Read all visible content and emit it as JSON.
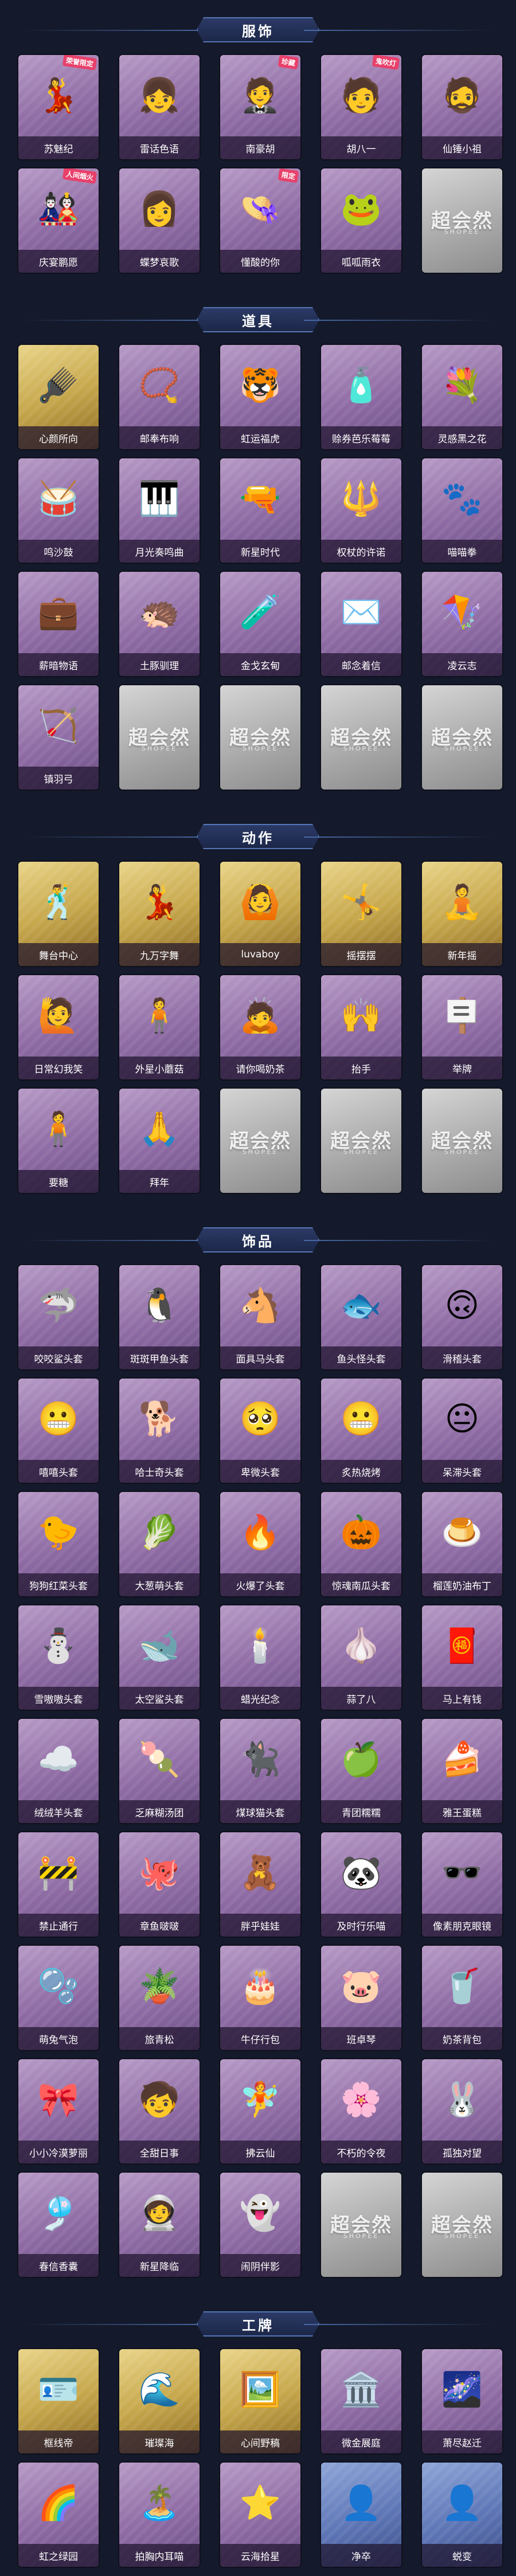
{
  "sections": [
    {
      "title": "服饰",
      "items": [
        {
          "label": "苏魅纪",
          "style": "purple",
          "icon": "💃",
          "tag": "荣誉限定"
        },
        {
          "label": "雷话色语",
          "style": "purple",
          "icon": "👧",
          "tag": ""
        },
        {
          "label": "南豪胡",
          "style": "purple",
          "icon": "🤵",
          "tag": "珍藏"
        },
        {
          "label": "胡八一",
          "style": "purple",
          "icon": "🧑",
          "tag": "鬼吹灯"
        },
        {
          "label": "仙锤小祖",
          "style": "purple",
          "icon": "🧔",
          "tag": ""
        },
        {
          "label": "庆宴鹏愿",
          "style": "purple",
          "icon": "🎎",
          "tag": "人间烟火"
        },
        {
          "label": "蝶梦哀歌",
          "style": "purple",
          "icon": "👩",
          "tag": ""
        },
        {
          "label": "懂酸的你",
          "style": "purple",
          "icon": "👒",
          "tag": "限定"
        },
        {
          "label": "呱呱雨衣",
          "style": "purple",
          "icon": "🐸",
          "tag": ""
        },
        {
          "label": "",
          "style": "placeholder",
          "icon": "",
          "tag": ""
        }
      ]
    },
    {
      "title": "道具",
      "items": [
        {
          "label": "心颜所向",
          "style": "gold",
          "icon": "🪮",
          "tag": ""
        },
        {
          "label": "邮奉布响",
          "style": "purple",
          "icon": "📿",
          "tag": ""
        },
        {
          "label": "虹运福虎",
          "style": "purple",
          "icon": "🐯",
          "tag": ""
        },
        {
          "label": "赊券芭乐莓莓",
          "style": "purple",
          "icon": "🧴",
          "tag": ""
        },
        {
          "label": "灵感黑之花",
          "style": "purple",
          "icon": "💐",
          "tag": ""
        },
        {
          "label": "鸣沙鼓",
          "style": "purple",
          "icon": "🥁",
          "tag": ""
        },
        {
          "label": "月光奏鸣曲",
          "style": "purple",
          "icon": "🎹",
          "tag": ""
        },
        {
          "label": "新星时代",
          "style": "purple",
          "icon": "🔫",
          "tag": ""
        },
        {
          "label": "权杖的许诺",
          "style": "purple",
          "icon": "🔱",
          "tag": ""
        },
        {
          "label": "喵喵拳",
          "style": "purple",
          "icon": "🐾",
          "tag": ""
        },
        {
          "label": "薪暗物语",
          "style": "purple",
          "icon": "💼",
          "tag": ""
        },
        {
          "label": "土豚驯理",
          "style": "purple",
          "icon": "🦔",
          "tag": ""
        },
        {
          "label": "金戈玄甸",
          "style": "purple",
          "icon": "🧪",
          "tag": ""
        },
        {
          "label": "邮念着信",
          "style": "purple",
          "icon": "✉️",
          "tag": ""
        },
        {
          "label": "凌云志",
          "style": "purple",
          "icon": "🪁",
          "tag": ""
        },
        {
          "label": "镇羽弓",
          "style": "purple",
          "icon": "🏹",
          "tag": ""
        },
        {
          "label": "",
          "style": "placeholder",
          "icon": "",
          "tag": ""
        },
        {
          "label": "",
          "style": "placeholder",
          "icon": "",
          "tag": ""
        },
        {
          "label": "",
          "style": "placeholder",
          "icon": "",
          "tag": ""
        },
        {
          "label": "",
          "style": "placeholder",
          "icon": "",
          "tag": ""
        }
      ]
    },
    {
      "title": "动作",
      "items": [
        {
          "label": "舞台中心",
          "style": "gold",
          "icon": "🕺",
          "tag": ""
        },
        {
          "label": "九万字舞",
          "style": "gold",
          "icon": "💃",
          "tag": ""
        },
        {
          "label": "luvaboy",
          "style": "gold",
          "icon": "🙆",
          "tag": ""
        },
        {
          "label": "摇摆摆",
          "style": "gold",
          "icon": "🤸",
          "tag": ""
        },
        {
          "label": "新年摇",
          "style": "gold",
          "icon": "🧘",
          "tag": ""
        },
        {
          "label": "日常幻我笑",
          "style": "purple",
          "icon": "🙋",
          "tag": ""
        },
        {
          "label": "外星小蘑菇",
          "style": "purple",
          "icon": "🧍",
          "tag": ""
        },
        {
          "label": "请你喝奶茶",
          "style": "purple",
          "icon": "🙇",
          "tag": ""
        },
        {
          "label": "抬手",
          "style": "purple",
          "icon": "🙌",
          "tag": ""
        },
        {
          "label": "举牌",
          "style": "purple",
          "icon": "🪧",
          "tag": ""
        },
        {
          "label": "要糖",
          "style": "purple",
          "icon": "🧍",
          "tag": ""
        },
        {
          "label": "拜年",
          "style": "purple",
          "icon": "🙏",
          "tag": ""
        },
        {
          "label": "",
          "style": "placeholder",
          "icon": "",
          "tag": ""
        },
        {
          "label": "",
          "style": "placeholder",
          "icon": "",
          "tag": ""
        },
        {
          "label": "",
          "style": "placeholder",
          "icon": "",
          "tag": ""
        }
      ]
    },
    {
      "title": "饰品",
      "items": [
        {
          "label": "咬咬鲨头套",
          "style": "purple",
          "icon": "🦈",
          "tag": ""
        },
        {
          "label": "斑斑甲鱼头套",
          "style": "purple",
          "icon": "🐧",
          "tag": ""
        },
        {
          "label": "面具马头套",
          "style": "purple",
          "icon": "🐴",
          "tag": ""
        },
        {
          "label": "鱼头怪头套",
          "style": "purple",
          "icon": "🐟",
          "tag": ""
        },
        {
          "label": "滑稽头套",
          "style": "purple",
          "icon": "🙃",
          "tag": ""
        },
        {
          "label": "嘻嘻头套",
          "style": "purple",
          "icon": "😬",
          "tag": ""
        },
        {
          "label": "哈士奇头套",
          "style": "purple",
          "icon": "🐕",
          "tag": ""
        },
        {
          "label": "卑微头套",
          "style": "purple",
          "icon": "🥺",
          "tag": ""
        },
        {
          "label": "炙热烧烤",
          "style": "purple",
          "icon": "😬",
          "tag": ""
        },
        {
          "label": "呆滞头套",
          "style": "purple",
          "icon": "😐",
          "tag": ""
        },
        {
          "label": "狗狗红菜头套",
          "style": "purple",
          "icon": "🐤",
          "tag": ""
        },
        {
          "label": "大葱萌头套",
          "style": "purple",
          "icon": "🥬",
          "tag": ""
        },
        {
          "label": "火爆了头套",
          "style": "purple",
          "icon": "🔥",
          "tag": ""
        },
        {
          "label": "惊魂南瓜头套",
          "style": "purple",
          "icon": "🎃",
          "tag": ""
        },
        {
          "label": "榴莲奶油布丁",
          "style": "purple",
          "icon": "🍮",
          "tag": ""
        },
        {
          "label": "雪嗷嗷头套",
          "style": "purple",
          "icon": "⛄",
          "tag": ""
        },
        {
          "label": "太空鲨头套",
          "style": "purple",
          "icon": "🐋",
          "tag": ""
        },
        {
          "label": "蜡光纪念",
          "style": "purple",
          "icon": "🕯️",
          "tag": ""
        },
        {
          "label": "蒜了八",
          "style": "purple",
          "icon": "🧄",
          "tag": ""
        },
        {
          "label": "马上有钱",
          "style": "purple",
          "icon": "🧧",
          "tag": ""
        },
        {
          "label": "绒绒羊头套",
          "style": "purple",
          "icon": "☁️",
          "tag": ""
        },
        {
          "label": "乏麻糊汤团",
          "style": "purple",
          "icon": "🍡",
          "tag": ""
        },
        {
          "label": "煤球猫头套",
          "style": "purple",
          "icon": "🐈‍⬛",
          "tag": ""
        },
        {
          "label": "青团糯糯",
          "style": "purple",
          "icon": "🍏",
          "tag": ""
        },
        {
          "label": "雅王蛋糕",
          "style": "purple",
          "icon": "🍰",
          "tag": ""
        },
        {
          "label": "禁止通行",
          "style": "purple",
          "icon": "🚧",
          "tag": ""
        },
        {
          "label": "章鱼啵啵",
          "style": "purple",
          "icon": "🐙",
          "tag": ""
        },
        {
          "label": "胖乎娃娃",
          "style": "purple",
          "icon": "🧸",
          "tag": ""
        },
        {
          "label": "及时行乐喵",
          "style": "purple",
          "icon": "🐼",
          "tag": ""
        },
        {
          "label": "像素朋克眼镜",
          "style": "purple",
          "icon": "🕶️",
          "tag": ""
        },
        {
          "label": "萌兔气泡",
          "style": "purple",
          "icon": "🫧",
          "tag": ""
        },
        {
          "label": "旅青松",
          "style": "purple",
          "icon": "🪴",
          "tag": ""
        },
        {
          "label": "牛仔行包",
          "style": "purple",
          "icon": "🎂",
          "tag": ""
        },
        {
          "label": "班卓琴",
          "style": "purple",
          "icon": "🐷",
          "tag": ""
        },
        {
          "label": "奶茶背包",
          "style": "purple",
          "icon": "🥤",
          "tag": ""
        },
        {
          "label": "小小冷漠萝丽",
          "style": "purple",
          "icon": "🎀",
          "tag": ""
        },
        {
          "label": "全甜日事",
          "style": "purple",
          "icon": "🧒",
          "tag": ""
        },
        {
          "label": "拂云仙",
          "style": "purple",
          "icon": "🧚",
          "tag": ""
        },
        {
          "label": "不朽的令夜",
          "style": "purple",
          "icon": "🌸",
          "tag": ""
        },
        {
          "label": "孤独对望",
          "style": "purple",
          "icon": "🐰",
          "tag": ""
        },
        {
          "label": "春信香囊",
          "style": "purple",
          "icon": "🎐",
          "tag": ""
        },
        {
          "label": "新星降临",
          "style": "purple",
          "icon": "🧑‍🚀",
          "tag": ""
        },
        {
          "label": "闹阴伴影",
          "style": "purple",
          "icon": "👻",
          "tag": ""
        },
        {
          "label": "",
          "style": "placeholder",
          "icon": "",
          "tag": ""
        },
        {
          "label": "",
          "style": "placeholder",
          "icon": "",
          "tag": ""
        }
      ]
    },
    {
      "title": "工牌",
      "items": [
        {
          "label": "框线帝",
          "style": "gold",
          "icon": "🪪",
          "tag": ""
        },
        {
          "label": "璀璨海",
          "style": "gold",
          "icon": "🌊",
          "tag": ""
        },
        {
          "label": "心间野稿",
          "style": "gold",
          "icon": "🖼️",
          "tag": ""
        },
        {
          "label": "微金展庭",
          "style": "purple",
          "icon": "🏛️",
          "tag": ""
        },
        {
          "label": "萧尽赵迁",
          "style": "purple",
          "icon": "🌌",
          "tag": ""
        },
        {
          "label": "虹之绿园",
          "style": "purple",
          "icon": "🌈",
          "tag": ""
        },
        {
          "label": "拍胸内耳喵",
          "style": "purple",
          "icon": "🏝️",
          "tag": ""
        },
        {
          "label": "云海拾星",
          "style": "purple",
          "icon": "⭐",
          "tag": ""
        },
        {
          "label": "净卒",
          "style": "blue",
          "icon": "👤",
          "tag": ""
        },
        {
          "label": "蜕变",
          "style": "blue",
          "icon": "👤",
          "tag": ""
        }
      ]
    }
  ],
  "placeholder_watermark": "超会然",
  "placeholder_sub": "SHOPEE"
}
